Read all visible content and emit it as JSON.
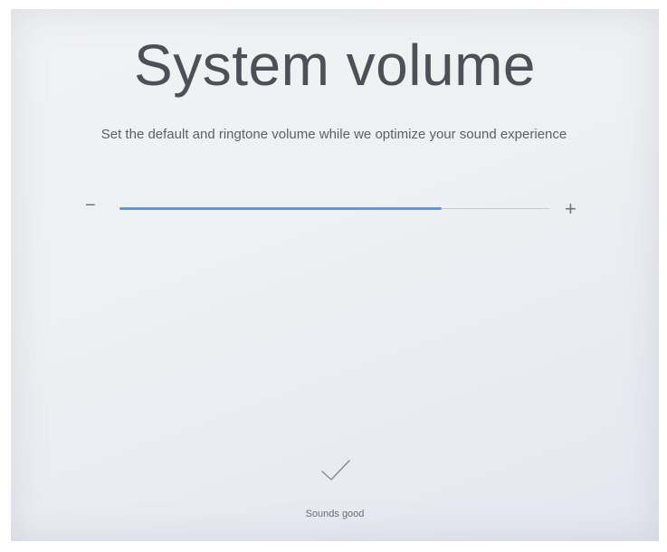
{
  "page": {
    "title": "System volume",
    "subtitle": "Set the default and ringtone volume while we optimize your sound experience"
  },
  "volume": {
    "decrease_symbol": "−",
    "increase_symbol": "+",
    "level_fraction": 0.75,
    "fill_color": "#5a9bd8"
  },
  "confirm": {
    "icon": "checkmark-icon",
    "label": "Sounds good"
  }
}
